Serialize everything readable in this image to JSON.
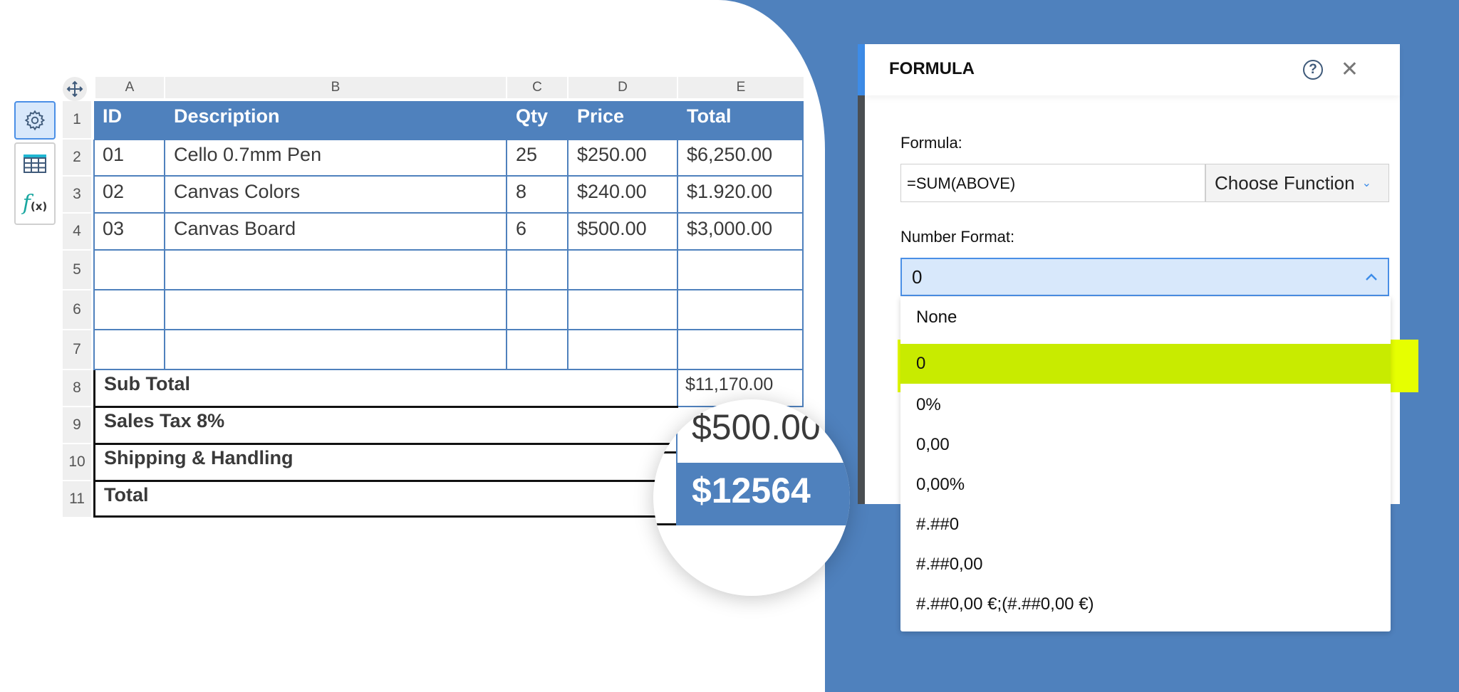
{
  "toolbar": {
    "items": [
      {
        "name": "settings",
        "icon": "gear-icon",
        "active": true
      },
      {
        "name": "table",
        "icon": "table-icon",
        "active": false
      },
      {
        "name": "formula",
        "icon": "function-icon",
        "label": "f",
        "sub": "(x)",
        "active": false
      }
    ]
  },
  "sheet": {
    "columns": [
      "A",
      "B",
      "C",
      "D",
      "E"
    ],
    "row_numbers": [
      "1",
      "2",
      "3",
      "4",
      "5",
      "6",
      "7",
      "8",
      "9",
      "10",
      "11"
    ],
    "header": [
      "ID",
      "Description",
      "Qty",
      "Price",
      "Total"
    ],
    "rows": [
      [
        "01",
        "Cello 0.7mm Pen",
        "25",
        "$250.00",
        "$6,250.00"
      ],
      [
        "02",
        "Canvas Colors",
        "8",
        "$240.00",
        "$1.920.00"
      ],
      [
        "03",
        "Canvas Board",
        "6",
        "$500.00",
        "$3,000.00"
      ],
      [
        "",
        "",
        "",
        "",
        ""
      ],
      [
        "",
        "",
        "",
        "",
        ""
      ],
      [
        "",
        "",
        "",
        "",
        ""
      ]
    ],
    "summary": [
      {
        "label": "Sub Total",
        "value": "$11,170.00"
      },
      {
        "label": "Sales Tax 8%",
        "value": ""
      },
      {
        "label": "Shipping & Handling",
        "value": ""
      },
      {
        "label": "Total",
        "value": ""
      }
    ]
  },
  "magnifier": {
    "shipping_value": "$500.00",
    "total_value": "$12564"
  },
  "dialog": {
    "title": "FORMULA",
    "help_icon": "?",
    "close_icon": "✕",
    "formula_label": "Formula:",
    "formula_value": "=SUM(ABOVE)",
    "choose_function_label": "Choose Function",
    "number_format_label": "Number Format:",
    "number_format_value": "0",
    "number_format_options": [
      "None",
      "0",
      "0%",
      "0,00",
      "0,00%",
      "#.##0",
      "#.##0,00",
      "#.##0,00 €;(#.##0,00 €)"
    ],
    "selected_option": "0"
  },
  "colors": {
    "brand_blue": "#4f81bd",
    "accent_blue": "#3d8ce8",
    "highlight": "#e6ff00"
  }
}
